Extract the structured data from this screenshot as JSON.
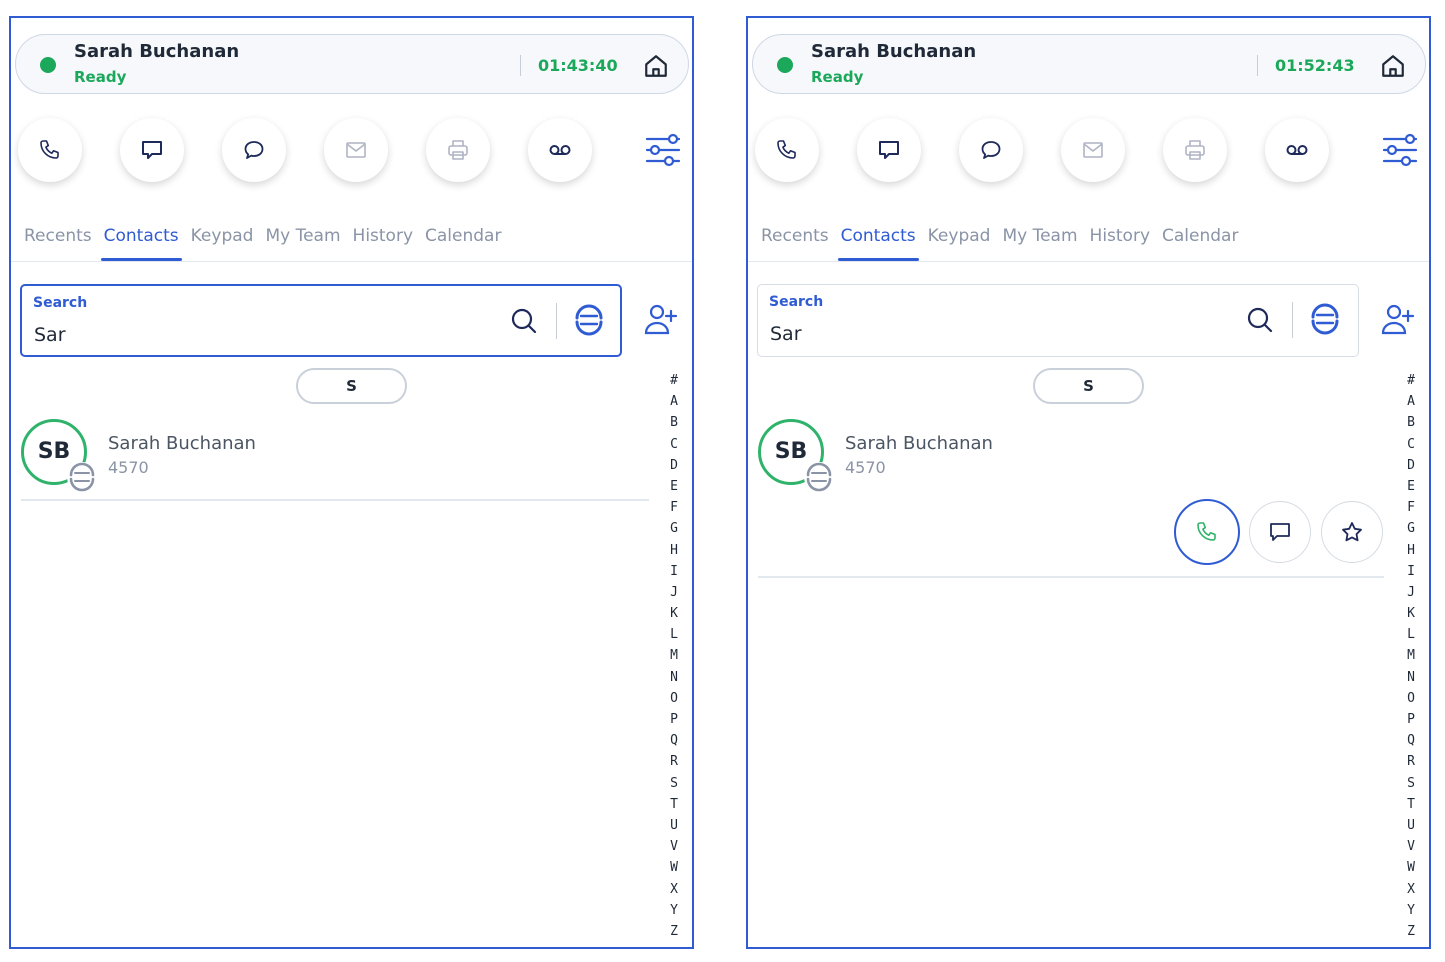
{
  "colors": {
    "accent": "#2f5bd3",
    "ready_green": "#1ca85a",
    "avatar_ring": "#2fb36b",
    "icon_navy": "#1e2a5a",
    "tab_inactive": "#8a94a6"
  },
  "panels": [
    {
      "status": {
        "name": "Sarah Buchanan",
        "state": "Ready",
        "timer": "01:43:40"
      },
      "actions": [
        {
          "icon": "phone-icon",
          "enabled": true
        },
        {
          "icon": "chat-bubble-icon",
          "enabled": true
        },
        {
          "icon": "message-circle-icon",
          "enabled": true
        },
        {
          "icon": "mail-icon",
          "enabled": false
        },
        {
          "icon": "printer-icon",
          "enabled": false
        },
        {
          "icon": "voicemail-icon",
          "enabled": true
        }
      ],
      "tabs": [
        {
          "label": "Recents"
        },
        {
          "label": "Contacts"
        },
        {
          "label": "Keypad"
        },
        {
          "label": "My Team"
        },
        {
          "label": "History"
        },
        {
          "label": "Calendar"
        }
      ],
      "active_tab": "Contacts",
      "search": {
        "label": "Search",
        "value": "Sar"
      },
      "letter_chip": "S",
      "contact": {
        "initials": "SB",
        "name": "Sarah Buchanan",
        "extension": "4570"
      },
      "row_actions_visible": false
    },
    {
      "status": {
        "name": "Sarah Buchanan",
        "state": "Ready",
        "timer": "01:52:43"
      },
      "actions": [
        {
          "icon": "phone-icon",
          "enabled": true
        },
        {
          "icon": "chat-bubble-icon",
          "enabled": true
        },
        {
          "icon": "message-circle-icon",
          "enabled": true
        },
        {
          "icon": "mail-icon",
          "enabled": false
        },
        {
          "icon": "printer-icon",
          "enabled": false
        },
        {
          "icon": "voicemail-icon",
          "enabled": true
        }
      ],
      "tabs": [
        {
          "label": "Recents"
        },
        {
          "label": "Contacts"
        },
        {
          "label": "Keypad"
        },
        {
          "label": "My Team"
        },
        {
          "label": "History"
        },
        {
          "label": "Calendar"
        }
      ],
      "active_tab": "Contacts",
      "search": {
        "label": "Search",
        "value": "Sar"
      },
      "letter_chip": "S",
      "contact": {
        "initials": "SB",
        "name": "Sarah Buchanan",
        "extension": "4570"
      },
      "row_actions_visible": true,
      "row_actions": [
        "phone-icon",
        "chat-bubble-icon",
        "star-icon"
      ]
    }
  ],
  "alphabet_index": [
    "#",
    "A",
    "B",
    "C",
    "D",
    "E",
    "F",
    "G",
    "H",
    "I",
    "J",
    "K",
    "L",
    "M",
    "N",
    "O",
    "P",
    "Q",
    "R",
    "S",
    "T",
    "U",
    "V",
    "W",
    "X",
    "Y",
    "Z"
  ]
}
